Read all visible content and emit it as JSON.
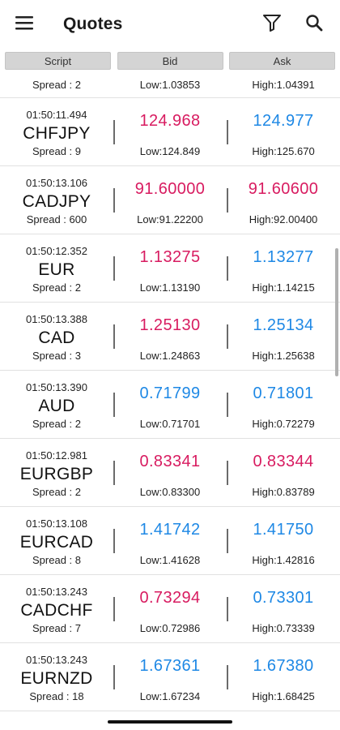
{
  "app_bar": {
    "title": "Quotes",
    "icons": [
      "menu-icon",
      "filter-icon",
      "search-icon"
    ]
  },
  "columns": {
    "script": "Script",
    "bid": "Bid",
    "ask": "Ask"
  },
  "partial_row": {
    "spread": "Spread : 2",
    "low": "Low:1.03853",
    "high": "High:1.04391"
  },
  "quotes": [
    {
      "time": "01:50:11.494",
      "symbol": "CHFJPY",
      "spread": "Spread : 9",
      "bid": "124.968",
      "bid_color": "red",
      "ask": "124.977",
      "ask_color": "blue",
      "low": "Low:124.849",
      "high": "High:125.670"
    },
    {
      "time": "01:50:13.106",
      "symbol": "CADJPY",
      "spread": "Spread : 600",
      "bid": "91.60000",
      "bid_color": "red",
      "ask": "91.60600",
      "ask_color": "red",
      "low": "Low:91.22200",
      "high": "High:92.00400"
    },
    {
      "time": "01:50:12.352",
      "symbol": "EUR",
      "spread": "Spread : 2",
      "bid": "1.13275",
      "bid_color": "red",
      "ask": "1.13277",
      "ask_color": "blue",
      "low": "Low:1.13190",
      "high": "High:1.14215"
    },
    {
      "time": "01:50:13.388",
      "symbol": "CAD",
      "spread": "Spread : 3",
      "bid": "1.25130",
      "bid_color": "red",
      "ask": "1.25134",
      "ask_color": "blue",
      "low": "Low:1.24863",
      "high": "High:1.25638"
    },
    {
      "time": "01:50:13.390",
      "symbol": "AUD",
      "spread": "Spread : 2",
      "bid": "0.71799",
      "bid_color": "blue",
      "ask": "0.71801",
      "ask_color": "blue",
      "low": "Low:0.71701",
      "high": "High:0.72279"
    },
    {
      "time": "01:50:12.981",
      "symbol": "EURGBP",
      "spread": "Spread : 2",
      "bid": "0.83341",
      "bid_color": "red",
      "ask": "0.83344",
      "ask_color": "red",
      "low": "Low:0.83300",
      "high": "High:0.83789"
    },
    {
      "time": "01:50:13.108",
      "symbol": "EURCAD",
      "spread": "Spread : 8",
      "bid": "1.41742",
      "bid_color": "blue",
      "ask": "1.41750",
      "ask_color": "blue",
      "low": "Low:1.41628",
      "high": "High:1.42816"
    },
    {
      "time": "01:50:13.243",
      "symbol": "CADCHF",
      "spread": "Spread : 7",
      "bid": "0.73294",
      "bid_color": "red",
      "ask": "0.73301",
      "ask_color": "blue",
      "low": "Low:0.72986",
      "high": "High:0.73339"
    },
    {
      "time": "01:50:13.243",
      "symbol": "EURNZD",
      "spread": "Spread : 18",
      "bid": "1.67361",
      "bid_color": "blue",
      "ask": "1.67380",
      "ask_color": "blue",
      "low": "Low:1.67234",
      "high": "High:1.68425"
    }
  ],
  "colors": {
    "red": "#d81b60",
    "blue": "#1e88e5"
  }
}
